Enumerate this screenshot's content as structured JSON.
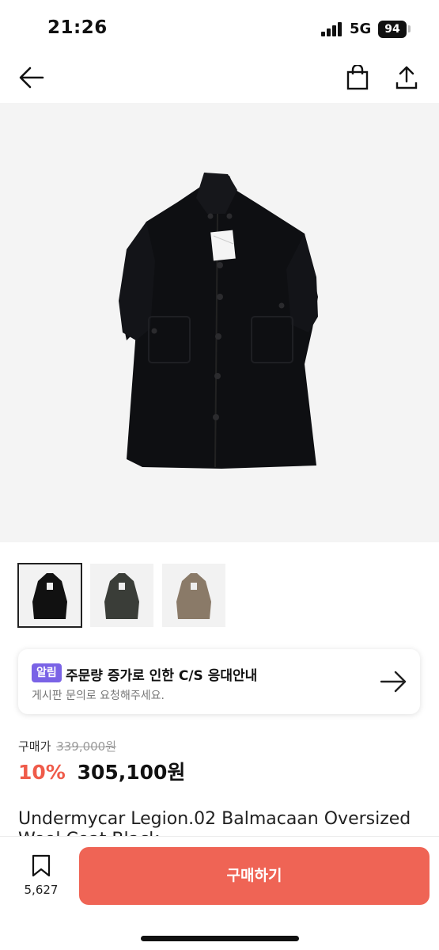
{
  "status": {
    "time": "21:26",
    "network": "5G",
    "battery": "94"
  },
  "nav": {
    "back_icon": "arrow-left-icon",
    "cart_icon": "shopping-bag-icon",
    "share_icon": "share-icon"
  },
  "product": {
    "thumbnails": [
      {
        "color": "#111111",
        "selected": true
      },
      {
        "color": "#3a3d38",
        "selected": false
      },
      {
        "color": "#8a7a68",
        "selected": false
      }
    ]
  },
  "notice": {
    "badge": "알림",
    "title": "주문량 증가로 인한 C/S 응대안내",
    "subtitle": "게시판 문의로 요청해주세요."
  },
  "price": {
    "label": "구매가",
    "original": "339,000원",
    "discount": "10%",
    "final": "305,100원"
  },
  "title_line1": "Undermycar Legion.02 Balmacaan Oversized",
  "title_line2": "Wool Coat Black",
  "bottom": {
    "like_count": "5,627",
    "buy_label": "구매하기"
  },
  "colors": {
    "accent": "#ef6455",
    "discount": "#ef5b4a",
    "badge": "#7a63e6"
  }
}
